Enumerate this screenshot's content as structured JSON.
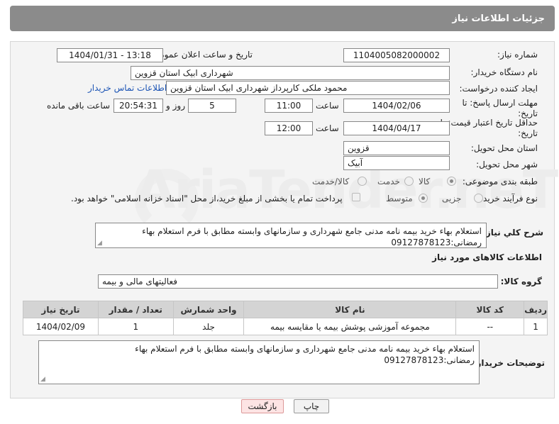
{
  "header": {
    "title": "جزئیات اطلاعات نیاز"
  },
  "form": {
    "need_number_label": "شماره نیاز:",
    "need_number": "1104005082000002",
    "announce_label": "تاریخ و ساعت اعلان عمومی:",
    "announce_value": "1404/01/31 - 13:18",
    "buyer_org_label": "نام دستگاه خریدار:",
    "buyer_org": "شهرداری ابیک استان قزوین",
    "creator_label": "ایجاد کننده درخواست:",
    "creator": "محمود ملکی کارپرداز شهرداری ابیک استان قزوین",
    "contact_link": "اطلاعات تماس خریدار",
    "deadline_label": "مهلت ارسال پاسخ: تا تاریخ:",
    "deadline_date": "1404/02/06",
    "time_label": "ساعت",
    "deadline_time": "11:00",
    "days_value": "5",
    "days_label": "روز و",
    "remaining_time": "20:54:31",
    "remaining_label": "ساعت باقی مانده",
    "validity_label": "حداقل تاریخ اعتبار قیمت: تا تاریخ:",
    "validity_date": "1404/04/17",
    "validity_time": "12:00",
    "province_label": "استان محل تحویل:",
    "province": "قزوین",
    "city_label": "شهر محل تحویل:",
    "city": "آبیک",
    "category_label": "طبقه بندی موضوعی:",
    "category_options": [
      "کالا",
      "خدمت",
      "کالا/خدمت"
    ],
    "process_label": "نوع فرآیند خرید :",
    "process_options": [
      "جزیی",
      "متوسط"
    ],
    "payment_note": "پرداخت تمام یا بخشی از مبلغ خرید،از محل \"اسناد خزانه اسلامی\" خواهد بود.",
    "description_label": "شرح کلي نياز:",
    "description": "استعلام بهاء خرید بیمه نامه مدنی جامع شهرداری و سازمانهای وابسته مطابق با فرم استعلام بهاء رمضانی:09127878123",
    "goods_info_title": "اطلاعات کالاهای مورد نیاز",
    "goods_group_label": "گروه کالا:",
    "goods_group": "فعالیتهای مالی و بیمه",
    "buyer_notes_label": "توضیحات خریدار:",
    "buyer_notes": "استعلام بهاء خرید بیمه نامه مدنی جامع شهرداری و سازمانهای وابسته مطابق با فرم استعلام بهاء رمضانی:09127878123"
  },
  "table": {
    "headers": [
      "ردیف",
      "کد کالا",
      "نام کالا",
      "واحد شمارش",
      "تعداد / مقدار",
      "تاریخ نیاز"
    ],
    "rows": [
      [
        "1",
        "--",
        "مجموعه آموزشی پوشش بیمه یا مقایسه بیمه",
        "جلد",
        "1",
        "1404/02/09"
      ]
    ]
  },
  "buttons": {
    "print": "چاپ",
    "back": "بازگشت"
  },
  "watermark": "AriaTender.neT",
  "colors": {
    "header_bg": "#8b8b8b",
    "link": "#1d55b5",
    "back_btn": "#fde4e4"
  }
}
